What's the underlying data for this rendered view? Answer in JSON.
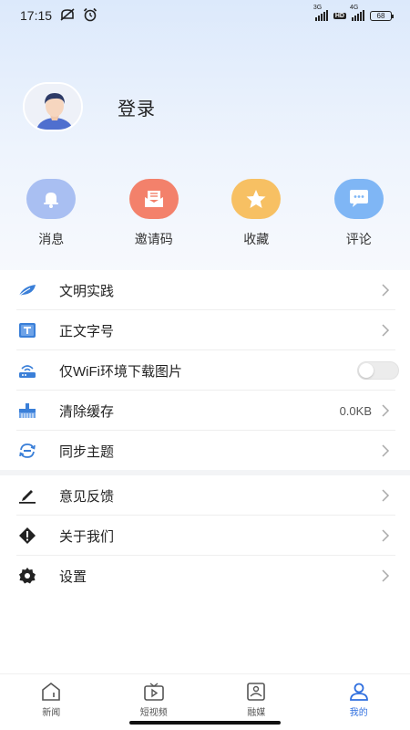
{
  "status_bar": {
    "time": "17:15",
    "signal_1_label": "3G",
    "signal_2_label": "4G",
    "hd_label": "HD",
    "battery": "68"
  },
  "profile": {
    "login_label": "登录"
  },
  "quick_actions": [
    {
      "label": "消息",
      "icon": "bell-icon",
      "color": "#a9bff2"
    },
    {
      "label": "邀请码",
      "icon": "invite-envelope-icon",
      "color": "#f3816b"
    },
    {
      "label": "收藏",
      "icon": "star-icon",
      "color": "#f7c063"
    },
    {
      "label": "评论",
      "icon": "comment-icon",
      "color": "#7fb6f5"
    }
  ],
  "menu_group_1": [
    {
      "label": "文明实践",
      "icon": "leaf-icon"
    },
    {
      "label": "正文字号",
      "icon": "font-size-icon"
    },
    {
      "label": "仅WiFi环境下载图片",
      "icon": "router-icon",
      "toggle": false
    },
    {
      "label": "清除缓存",
      "icon": "broom-icon",
      "value": "0.0KB"
    },
    {
      "label": "同步主题",
      "icon": "sync-icon"
    }
  ],
  "menu_group_2": [
    {
      "label": "意见反馈",
      "icon": "pencil-icon"
    },
    {
      "label": "关于我们",
      "icon": "warning-diamond-icon"
    },
    {
      "label": "设置",
      "icon": "gear-icon"
    }
  ],
  "bottom_nav": [
    {
      "label": "新闻",
      "icon": "news-home-icon",
      "active": false
    },
    {
      "label": "短视频",
      "icon": "video-icon",
      "active": false
    },
    {
      "label": "融媒",
      "icon": "media-icon",
      "active": false
    },
    {
      "label": "我的",
      "icon": "user-icon",
      "active": true
    }
  ],
  "colors": {
    "accent": "#2f6fdf",
    "menu_icon_blue": "#3a7fd8"
  }
}
